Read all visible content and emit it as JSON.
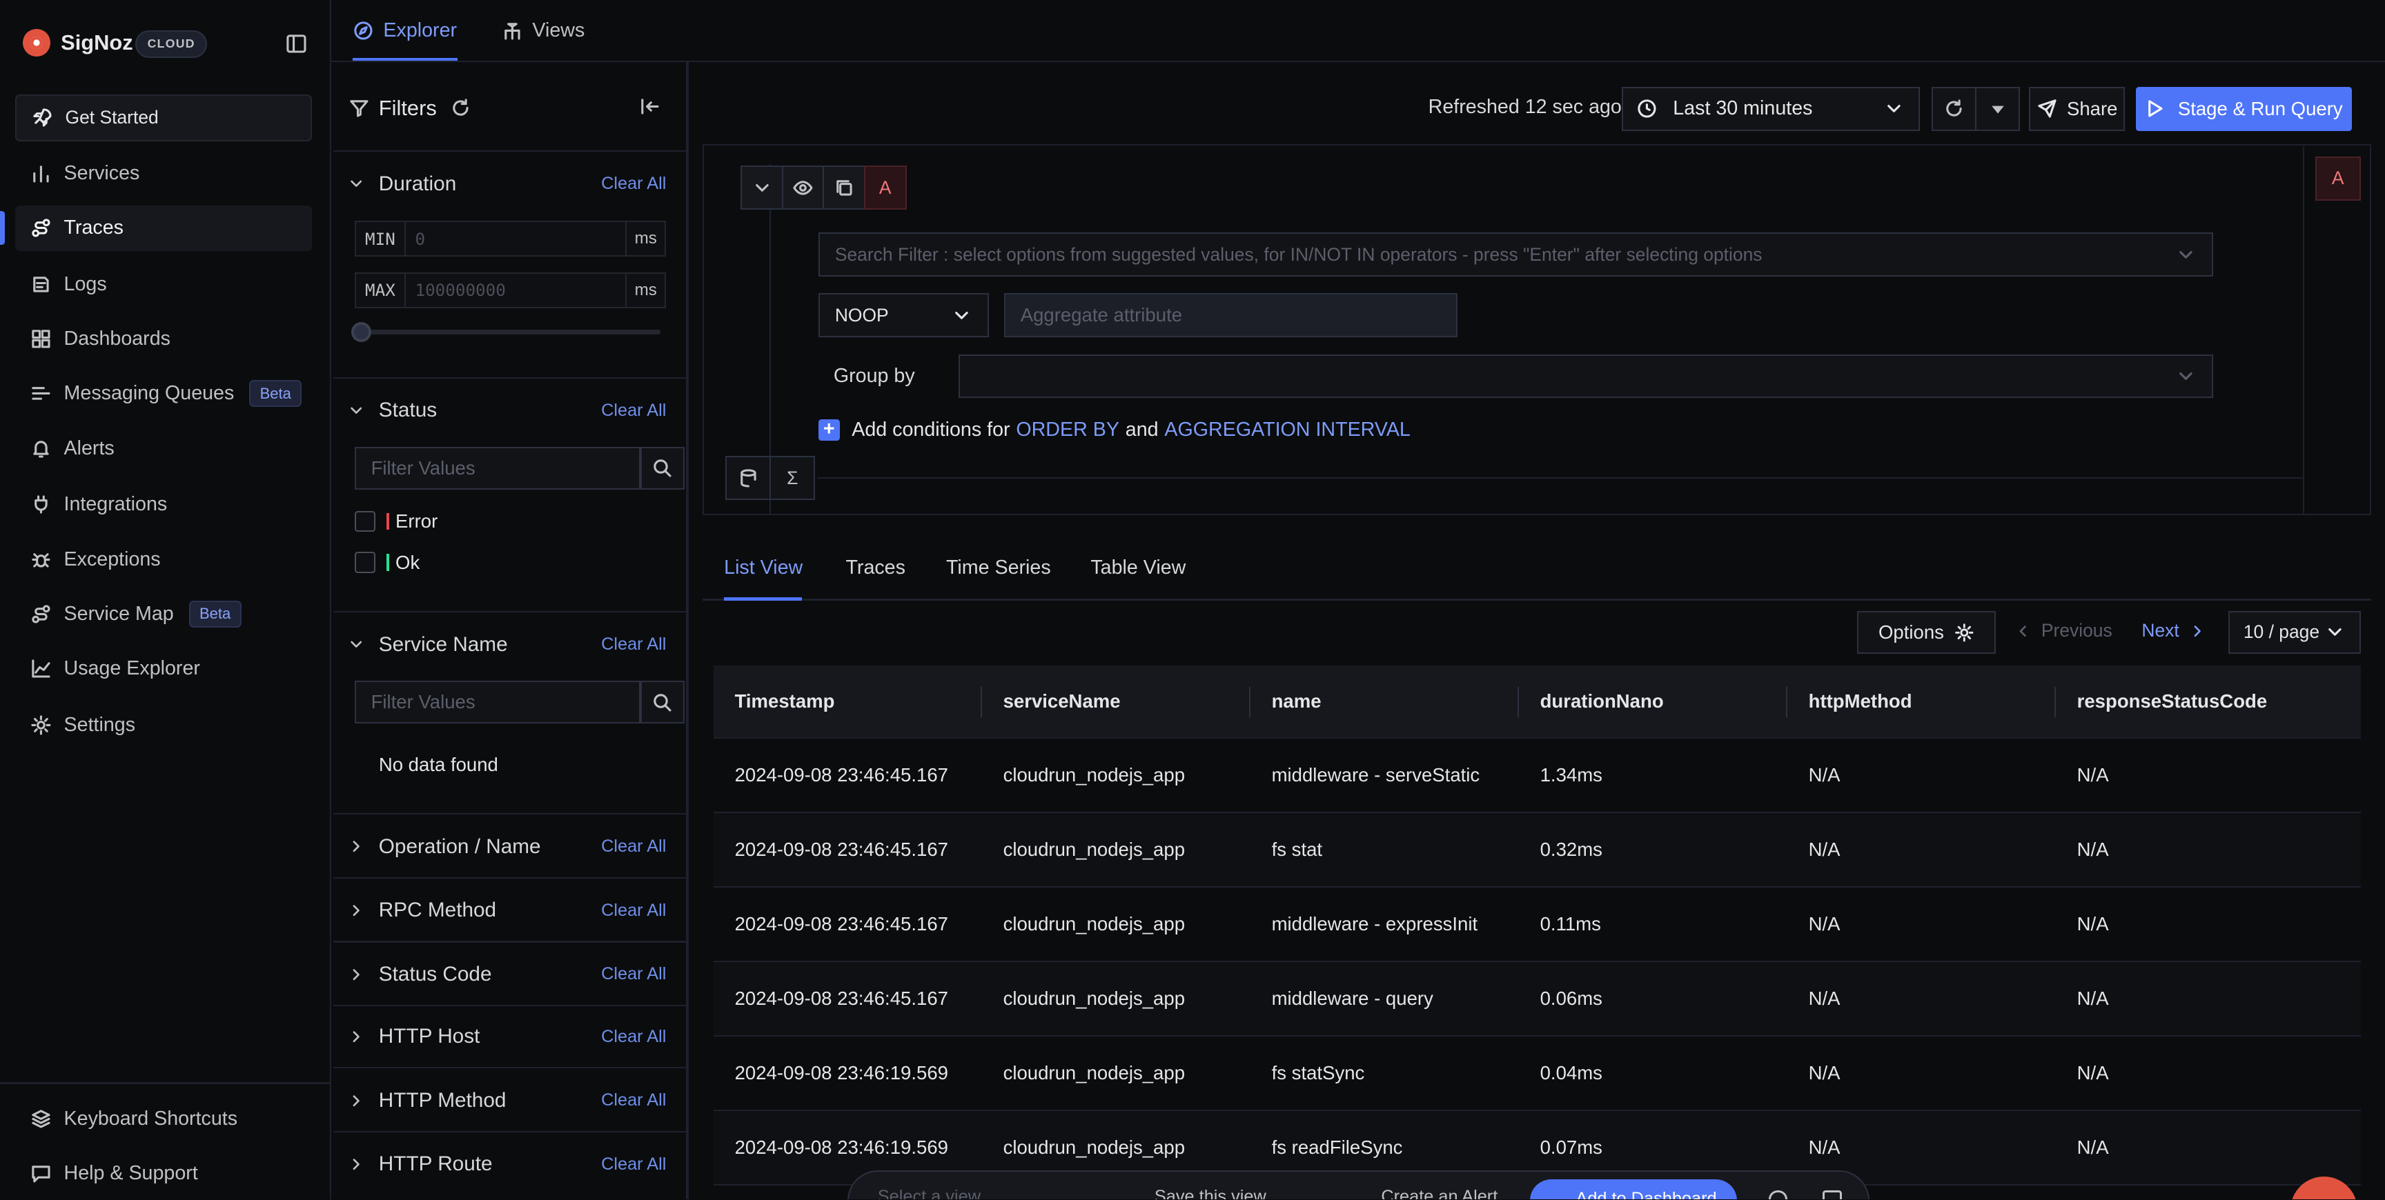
{
  "brand": {
    "name": "SigNoz",
    "badge": "CLOUD"
  },
  "sidebar": {
    "get_started": "Get Started",
    "items": [
      {
        "label": "Services",
        "icon": "bar-chart-icon"
      },
      {
        "label": "Traces",
        "icon": "route-icon"
      },
      {
        "label": "Logs",
        "icon": "logs-icon"
      },
      {
        "label": "Dashboards",
        "icon": "layout-grid-icon"
      },
      {
        "label": "Messaging Queues",
        "icon": "list-icon",
        "badge": "Beta"
      },
      {
        "label": "Alerts",
        "icon": "bell-icon"
      },
      {
        "label": "Integrations",
        "icon": "plug-icon"
      },
      {
        "label": "Exceptions",
        "icon": "bug-icon"
      },
      {
        "label": "Service Map",
        "icon": "route-icon",
        "badge": "Beta"
      },
      {
        "label": "Usage Explorer",
        "icon": "line-chart-icon"
      },
      {
        "label": "Settings",
        "icon": "gear-icon"
      }
    ],
    "active": "Traces",
    "footer": [
      {
        "label": "Keyboard Shortcuts",
        "icon": "layers-icon"
      },
      {
        "label": "Help & Support",
        "icon": "message-icon"
      }
    ]
  },
  "top_tabs": {
    "explorer": "Explorer",
    "views": "Views",
    "active": "Explorer"
  },
  "filters": {
    "title": "Filters",
    "clear_all": "Clear All",
    "duration": {
      "label": "Duration",
      "min_key": "MIN",
      "min_placeholder": "0",
      "max_key": "MAX",
      "max_placeholder": "100000000",
      "unit": "ms"
    },
    "status": {
      "label": "Status",
      "placeholder": "Filter Values",
      "options": [
        {
          "label": "Error",
          "color": "#e5484d"
        },
        {
          "label": "Ok",
          "color": "#25e192"
        }
      ]
    },
    "service_name": {
      "label": "Service Name",
      "placeholder": "Filter Values",
      "empty": "No data found"
    },
    "collapsed": [
      "Operation / Name",
      "RPC Method",
      "Status Code",
      "HTTP Host",
      "HTTP Method",
      "HTTP Route"
    ]
  },
  "toolbar": {
    "refreshed": "Refreshed 12 sec ago",
    "time_range": "Last 30 minutes",
    "share": "Share",
    "run": "Stage & Run Query"
  },
  "query": {
    "label": "A",
    "search_placeholder": "Search Filter : select options from suggested values, for IN/NOT IN operators - press \"Enter\" after selecting options",
    "aggregate_op": "NOOP",
    "aggregate_attr_placeholder": "Aggregate attribute",
    "group_by": "Group by",
    "add_conditions": {
      "prefix": "Add conditions for",
      "order_by": "ORDER BY",
      "and": "and",
      "interval": "AGGREGATION INTERVAL"
    },
    "sigma": "Σ"
  },
  "view_tabs": {
    "list": "List View",
    "traces": "Traces",
    "time_series": "Time Series",
    "table": "Table View",
    "active": "List View"
  },
  "table_controls": {
    "options": "Options",
    "previous": "Previous",
    "next": "Next",
    "per_page": "10 / page"
  },
  "table": {
    "columns": [
      "Timestamp",
      "serviceName",
      "name",
      "durationNano",
      "httpMethod",
      "responseStatusCode"
    ],
    "rows": [
      [
        "2024-09-08 23:46:45.167",
        "cloudrun_nodejs_app",
        "middleware - serveStatic",
        "1.34ms",
        "N/A",
        "N/A"
      ],
      [
        "2024-09-08 23:46:45.167",
        "cloudrun_nodejs_app",
        "fs stat",
        "0.32ms",
        "N/A",
        "N/A"
      ],
      [
        "2024-09-08 23:46:45.167",
        "cloudrun_nodejs_app",
        "middleware - expressInit",
        "0.11ms",
        "N/A",
        "N/A"
      ],
      [
        "2024-09-08 23:46:45.167",
        "cloudrun_nodejs_app",
        "middleware - query",
        "0.06ms",
        "N/A",
        "N/A"
      ],
      [
        "2024-09-08 23:46:19.569",
        "cloudrun_nodejs_app",
        "fs statSync",
        "0.04ms",
        "N/A",
        "N/A"
      ],
      [
        "2024-09-08 23:46:19.569",
        "cloudrun_nodejs_app",
        "fs readFileSync",
        "0.07ms",
        "N/A",
        "N/A"
      ]
    ]
  },
  "bottom_bar": {
    "select_view": "Select a view",
    "save_view": "Save this view",
    "create_alert": "Create an Alert",
    "add_dashboard": "Add to Dashboard"
  },
  "colors": {
    "accent": "#4e74f8",
    "brand": "#e2533f"
  }
}
